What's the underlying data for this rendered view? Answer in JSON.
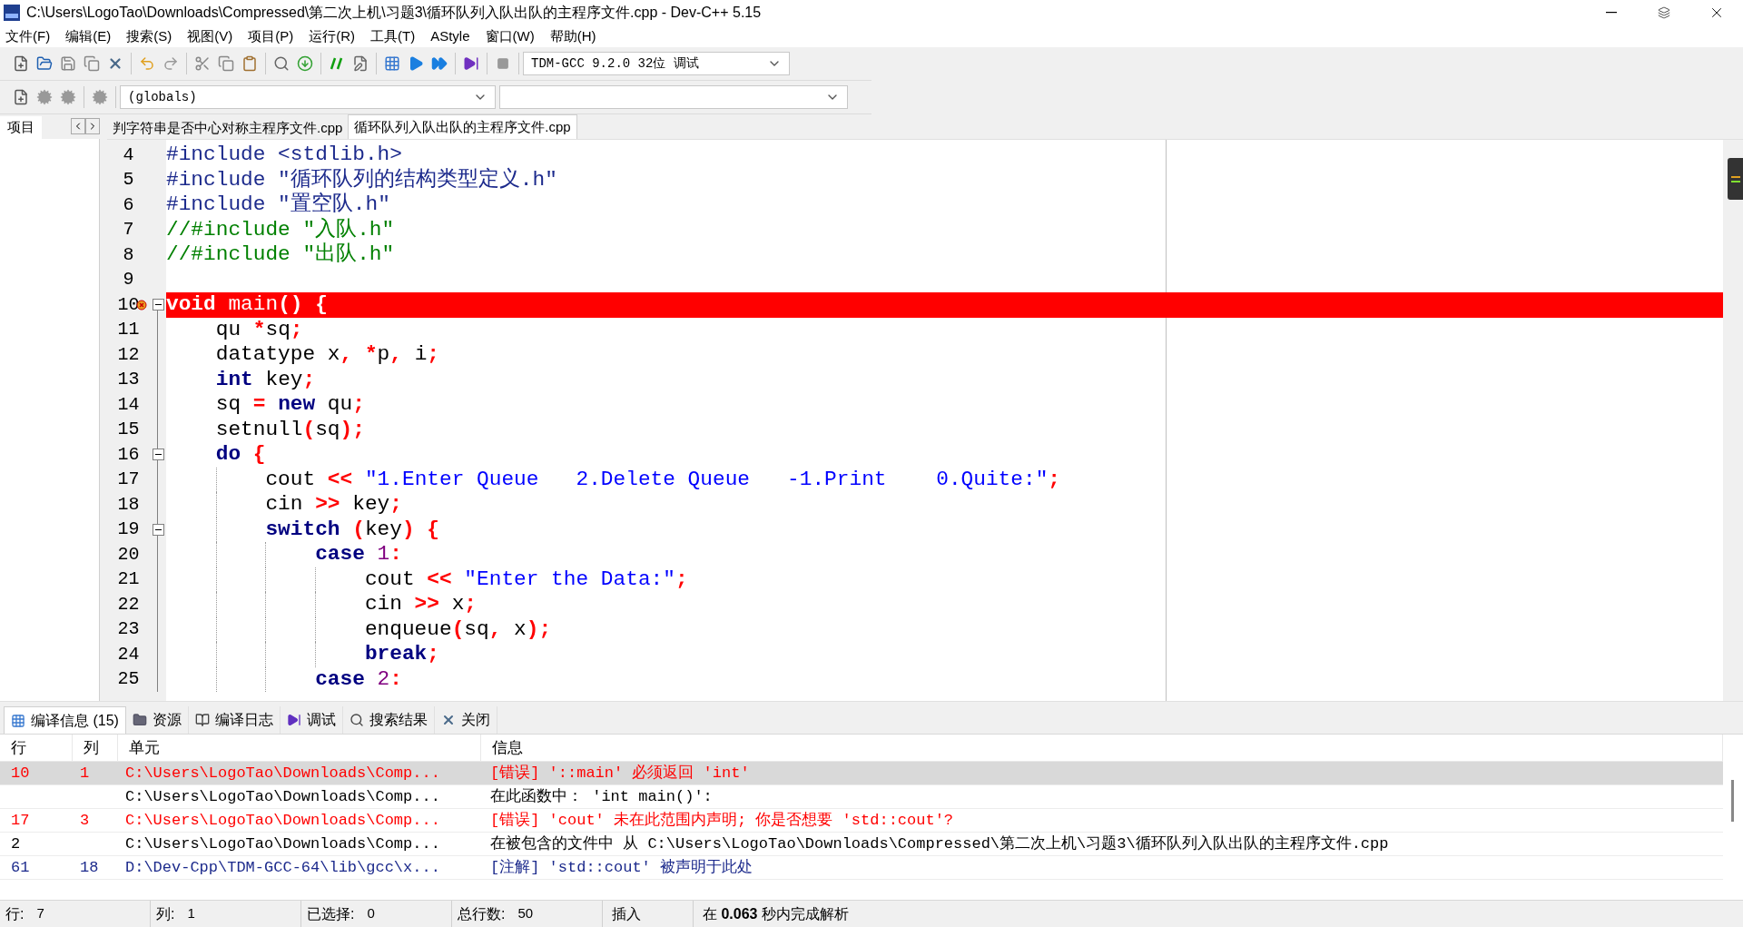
{
  "window": {
    "title": "C:\\Users\\LogoTao\\Downloads\\Compressed\\第二次上机\\习题3\\循环队列入队出队的主程序文件.cpp - Dev-C++ 5.15"
  },
  "menu": [
    "文件(F)",
    "编辑(E)",
    "搜索(S)",
    "视图(V)",
    "项目(P)",
    "运行(R)",
    "工具(T)",
    "AStyle",
    "窗口(W)",
    "帮助(H)"
  ],
  "toolbar": {
    "compiler": "TDM-GCC 9.2.0 32位 调试",
    "scope": "(globals)"
  },
  "left_panel": {
    "tabs": [
      {
        "label": "项目",
        "selected": true
      }
    ]
  },
  "editor_tabs": [
    {
      "label": "判字符串是否中心对称主程序文件.cpp",
      "selected": false
    },
    {
      "label": "循环队列入队出队的主程序文件.cpp",
      "selected": true
    }
  ],
  "code_lines": [
    {
      "number": "4",
      "error": false,
      "fold": false,
      "tokens": [
        {
          "kind": "preproc",
          "text": "#include <stdlib.h>"
        }
      ]
    },
    {
      "number": "5",
      "error": false,
      "fold": false,
      "tokens": [
        {
          "kind": "preproc",
          "text": "#include \"循环队列的结构类型定义.h\""
        }
      ]
    },
    {
      "number": "6",
      "error": false,
      "fold": false,
      "tokens": [
        {
          "kind": "preproc",
          "text": "#include \"置空队.h\""
        }
      ]
    },
    {
      "number": "7",
      "error": false,
      "fold": false,
      "tokens": [
        {
          "kind": "comment",
          "text": "//#include \"入队.h\""
        }
      ]
    },
    {
      "number": "8",
      "error": false,
      "fold": false,
      "tokens": [
        {
          "kind": "comment",
          "text": "//#include \"出队.h\""
        }
      ]
    },
    {
      "number": "9",
      "error": false,
      "fold": false
    },
    {
      "number": "10",
      "error": true,
      "fold": true,
      "tokens": [
        {
          "kind": "keyword",
          "text": "void"
        },
        {
          "kind": "ident",
          "text": " main"
        },
        {
          "kind": "symbol",
          "text": "()"
        },
        {
          "kind": "symbol",
          "text": " {"
        }
      ]
    },
    {
      "number": "11",
      "error": false,
      "fold": false,
      "tokens": [
        {
          "kind": "ident",
          "text": "    qu "
        },
        {
          "kind": "symbol",
          "text": "*"
        },
        {
          "kind": "ident",
          "text": "sq"
        },
        {
          "kind": "symbol",
          "text": ";"
        }
      ]
    },
    {
      "number": "12",
      "error": false,
      "fold": false,
      "tokens": [
        {
          "kind": "ident",
          "text": "    datatype x"
        },
        {
          "kind": "symbol",
          "text": ","
        },
        {
          "kind": "symbol",
          "text": " *"
        },
        {
          "kind": "ident",
          "text": "p"
        },
        {
          "kind": "symbol",
          "text": ","
        },
        {
          "kind": "ident",
          "text": " i"
        },
        {
          "kind": "symbol",
          "text": ";"
        }
      ]
    },
    {
      "number": "13",
      "error": false,
      "fold": false,
      "tokens": [
        {
          "kind": "keyword",
          "text": "    int"
        },
        {
          "kind": "ident",
          "text": " key"
        },
        {
          "kind": "symbol",
          "text": ";"
        }
      ]
    },
    {
      "number": "14",
      "error": false,
      "fold": false,
      "tokens": [
        {
          "kind": "ident",
          "text": "    sq "
        },
        {
          "kind": "symbol",
          "text": "="
        },
        {
          "kind": "keyword",
          "text": " new"
        },
        {
          "kind": "ident",
          "text": " qu"
        },
        {
          "kind": "symbol",
          "text": ";"
        }
      ]
    },
    {
      "number": "15",
      "error": false,
      "fold": false,
      "tokens": [
        {
          "kind": "ident",
          "text": "    setnull"
        },
        {
          "kind": "symbol",
          "text": "("
        },
        {
          "kind": "ident",
          "text": "sq"
        },
        {
          "kind": "symbol",
          "text": ");"
        }
      ]
    },
    {
      "number": "16",
      "error": false,
      "fold": true,
      "tokens": [
        {
          "kind": "keyword",
          "text": "    do"
        },
        {
          "kind": "symbol",
          "text": " {"
        }
      ]
    },
    {
      "number": "17",
      "error": false,
      "fold": false,
      "tokens": [
        {
          "kind": "ident",
          "text": "        cout "
        },
        {
          "kind": "symbol",
          "text": "<<"
        },
        {
          "kind": "string",
          "text": " \"1.Enter Queue   2.Delete Queue   -1.Print    0.Quite:\""
        },
        {
          "kind": "symbol",
          "text": ";"
        }
      ]
    },
    {
      "number": "18",
      "error": false,
      "fold": false,
      "tokens": [
        {
          "kind": "ident",
          "text": "        cin "
        },
        {
          "kind": "symbol",
          "text": ">>"
        },
        {
          "kind": "ident",
          "text": " key"
        },
        {
          "kind": "symbol",
          "text": ";"
        }
      ]
    },
    {
      "number": "19",
      "error": false,
      "fold": true,
      "tokens": [
        {
          "kind": "keyword",
          "text": "        switch"
        },
        {
          "kind": "symbol",
          "text": " ("
        },
        {
          "kind": "ident",
          "text": "key"
        },
        {
          "kind": "symbol",
          "text": ")"
        },
        {
          "kind": "symbol",
          "text": " {"
        }
      ]
    },
    {
      "number": "20",
      "error": false,
      "fold": false,
      "tokens": [
        {
          "kind": "keyword",
          "text": "            case"
        },
        {
          "kind": "number",
          "text": " 1"
        },
        {
          "kind": "symbol",
          "text": ":"
        }
      ]
    },
    {
      "number": "21",
      "error": false,
      "fold": false,
      "tokens": [
        {
          "kind": "ident",
          "text": "                cout "
        },
        {
          "kind": "symbol",
          "text": "<<"
        },
        {
          "kind": "string",
          "text": " \"Enter the Data:\""
        },
        {
          "kind": "symbol",
          "text": ";"
        }
      ]
    },
    {
      "number": "22",
      "error": false,
      "fold": false,
      "tokens": [
        {
          "kind": "ident",
          "text": "                cin "
        },
        {
          "kind": "symbol",
          "text": ">>"
        },
        {
          "kind": "ident",
          "text": " x"
        },
        {
          "kind": "symbol",
          "text": ";"
        }
      ]
    },
    {
      "number": "23",
      "error": false,
      "fold": false,
      "tokens": [
        {
          "kind": "ident",
          "text": "                enqueue"
        },
        {
          "kind": "symbol",
          "text": "("
        },
        {
          "kind": "ident",
          "text": "sq"
        },
        {
          "kind": "symbol",
          "text": ","
        },
        {
          "kind": "ident",
          "text": " x"
        },
        {
          "kind": "symbol",
          "text": ");"
        }
      ]
    },
    {
      "number": "24",
      "error": false,
      "fold": false,
      "tokens": [
        {
          "kind": "keyword",
          "text": "                break"
        },
        {
          "kind": "symbol",
          "text": ";"
        }
      ]
    },
    {
      "number": "25",
      "error": false,
      "fold": false,
      "tokens": [
        {
          "kind": "keyword",
          "text": "            case"
        },
        {
          "kind": "number",
          "text": " 2"
        },
        {
          "kind": "symbol",
          "text": ":"
        }
      ]
    }
  ],
  "bottom_tabs": [
    {
      "label": "编译信息 (15)",
      "selected": true
    },
    {
      "label": "资源",
      "selected": false
    },
    {
      "label": "编译日志",
      "selected": false
    },
    {
      "label": "调试",
      "selected": false
    },
    {
      "label": "搜索结果",
      "selected": false
    },
    {
      "label": "关闭",
      "selected": false
    }
  ],
  "messages": {
    "columns": [
      "行",
      "列",
      "单元",
      "信息"
    ],
    "rows": [
      {
        "kind": "error",
        "selected": true,
        "line": "10",
        "col": "1",
        "unit": "C:\\Users\\LogoTao\\Downloads\\Comp...",
        "message": "[错误] '::main' 必须返回 'int'"
      },
      {
        "kind": "info",
        "selected": false,
        "line": "",
        "col": "",
        "unit": "C:\\Users\\LogoTao\\Downloads\\Comp...",
        "message": "在此函数中： 'int main()':"
      },
      {
        "kind": "error",
        "selected": false,
        "line": "17",
        "col": "3",
        "unit": "C:\\Users\\LogoTao\\Downloads\\Comp...",
        "message": "[错误] 'cout' 未在此范围内声明; 你是否想要 'std::cout'?"
      },
      {
        "kind": "info",
        "selected": false,
        "line": "2",
        "col": "",
        "unit": "C:\\Users\\LogoTao\\Downloads\\Comp...",
        "message": "在被包含的文件中 从 C:\\Users\\LogoTao\\Downloads\\Compressed\\第二次上机\\习题3\\循环队列入队出队的主程序文件.cpp"
      },
      {
        "kind": "note",
        "selected": false,
        "line": "61",
        "col": "18",
        "unit": "D:\\Dev-Cpp\\TDM-GCC-64\\lib\\gcc\\x...",
        "message": "[注解] 'std::cout' 被声明于此处"
      }
    ]
  },
  "status_bar": {
    "fields": [
      {
        "label": "行:",
        "value": "7"
      },
      {
        "label": "列:",
        "value": "1"
      },
      {
        "label": "已选择:",
        "value": "0"
      },
      {
        "label": "总行数:",
        "value": "50"
      }
    ],
    "mode": "插入",
    "parse_info": "在 **0.063** 秒内完成解析"
  }
}
